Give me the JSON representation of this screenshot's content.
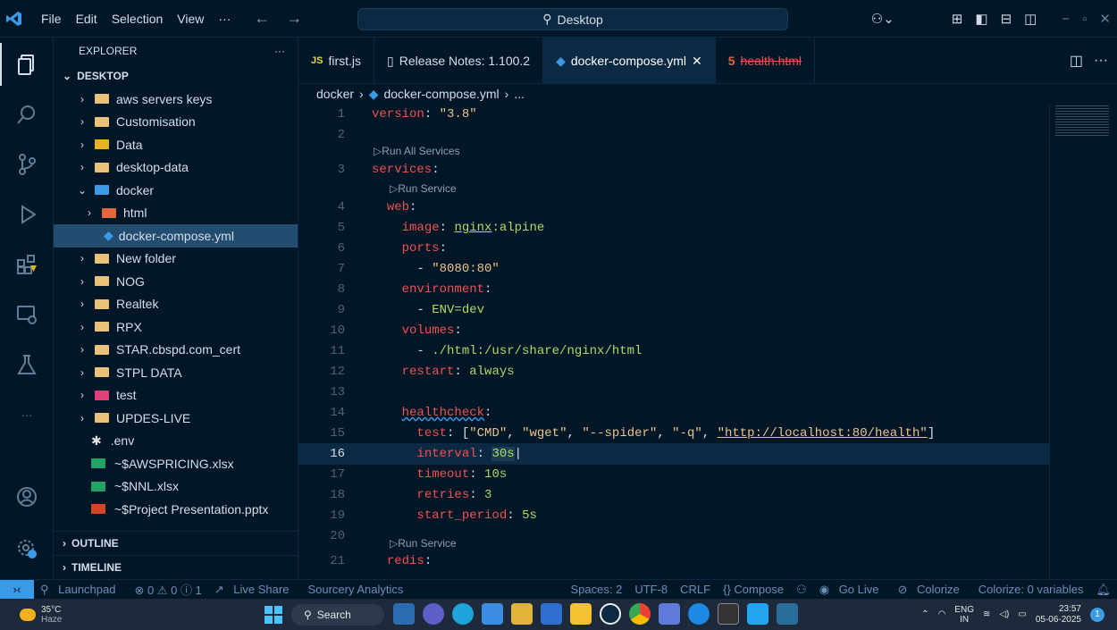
{
  "menubar": {
    "items": [
      "File",
      "Edit",
      "Selection",
      "View",
      "···"
    ]
  },
  "command_center": {
    "label": "Desktop"
  },
  "sidebar": {
    "title": "EXPLORER",
    "more": "···",
    "section": "DESKTOP",
    "tree": [
      {
        "label": "aws servers keys",
        "type": "folder",
        "depth": 0
      },
      {
        "label": "Customisation",
        "type": "folder",
        "depth": 0
      },
      {
        "label": "Data",
        "type": "folder",
        "depth": 0
      },
      {
        "label": "desktop-data",
        "type": "folder",
        "depth": 0
      },
      {
        "label": "docker",
        "type": "folder-open",
        "depth": 0
      },
      {
        "label": "html",
        "type": "folder",
        "depth": 1
      },
      {
        "label": "docker-compose.yml",
        "type": "file",
        "depth": 2
      },
      {
        "label": "New folder",
        "type": "folder",
        "depth": 0
      },
      {
        "label": "NOG",
        "type": "folder",
        "depth": 0
      },
      {
        "label": "Realtek",
        "type": "folder",
        "depth": 0
      },
      {
        "label": "RPX",
        "type": "folder",
        "depth": 0
      },
      {
        "label": "STAR.cbspd.com_cert",
        "type": "folder",
        "depth": 0
      },
      {
        "label": "STPL DATA",
        "type": "folder",
        "depth": 0
      },
      {
        "label": "test",
        "type": "folder",
        "depth": 0
      },
      {
        "label": "UPDES-LIVE",
        "type": "folder",
        "depth": 0
      },
      {
        "label": ".env",
        "type": "file",
        "depth": 1
      },
      {
        "label": "~$AWSPRICING.xlsx",
        "type": "file",
        "depth": 1
      },
      {
        "label": "~$NNL.xlsx",
        "type": "file",
        "depth": 1
      },
      {
        "label": "~$Project Presentation.pptx",
        "type": "file",
        "depth": 1
      }
    ],
    "outline": "OUTLINE",
    "timeline": "TIMELINE"
  },
  "tabs": [
    {
      "label": "first.js",
      "badge": "JS"
    },
    {
      "label": "Release Notes: 1.100.2"
    },
    {
      "label": "docker-compose.yml",
      "close": "✕"
    },
    {
      "label": "health.html"
    }
  ],
  "breadcrumb": {
    "folder": "docker",
    "file": "docker-compose.yml",
    "rest": "..."
  },
  "codelens": {
    "run_all": "Run All Services",
    "run_service": "Run Service"
  },
  "editor": {
    "lines": [
      {
        "n": "1",
        "text": "version: \"3.8\""
      },
      {
        "n": "2",
        "text": ""
      },
      {
        "n": "3",
        "text": "services:"
      },
      {
        "n": "4",
        "text": "  web:"
      },
      {
        "n": "5",
        "text": "    image: nginx:alpine"
      },
      {
        "n": "6",
        "text": "    ports:"
      },
      {
        "n": "7",
        "text": "      - \"8080:80\""
      },
      {
        "n": "8",
        "text": "    environment:"
      },
      {
        "n": "9",
        "text": "      - ENV=dev"
      },
      {
        "n": "10",
        "text": "    volumes:"
      },
      {
        "n": "11",
        "text": "      - ./html:/usr/share/nginx/html"
      },
      {
        "n": "12",
        "text": "    restart: always"
      },
      {
        "n": "13",
        "text": ""
      },
      {
        "n": "14",
        "text": "    healthcheck:"
      },
      {
        "n": "15",
        "text": "      test: [\"CMD\", \"wget\", \"--spider\", \"-q\", \"http://localhost:80/health\"]"
      },
      {
        "n": "16",
        "text": "      interval: 30s"
      },
      {
        "n": "17",
        "text": "      timeout: 10s"
      },
      {
        "n": "18",
        "text": "      retries: 3"
      },
      {
        "n": "19",
        "text": "      start_period: 5s"
      },
      {
        "n": "20",
        "text": ""
      },
      {
        "n": "21",
        "text": "  redis:"
      }
    ]
  },
  "statusbar": {
    "launchpad": "Launchpad",
    "problems": "⊗ 0 ⚠ 0 ⓘ 1",
    "liveshare": "Live Share",
    "sourcery": "Sourcery Analytics",
    "spaces": "Spaces: 2",
    "encoding": "UTF-8",
    "eol": "CRLF",
    "lang": "{} Compose",
    "golive": "Go Live",
    "colorize": "Colorize",
    "colorize_vars": "Colorize: 0 variables"
  },
  "taskbar": {
    "temp": "35°C",
    "weather": "Haze",
    "search": "Search",
    "lang": "ENG",
    "region": "IN",
    "time": "23:57",
    "date": "05-06-2025",
    "notif": "1"
  },
  "colors": {
    "accent": "#3b9ae6",
    "bg": "#011627",
    "key": "#ef5350",
    "string": "#ecc48d",
    "value": "#addb67"
  }
}
